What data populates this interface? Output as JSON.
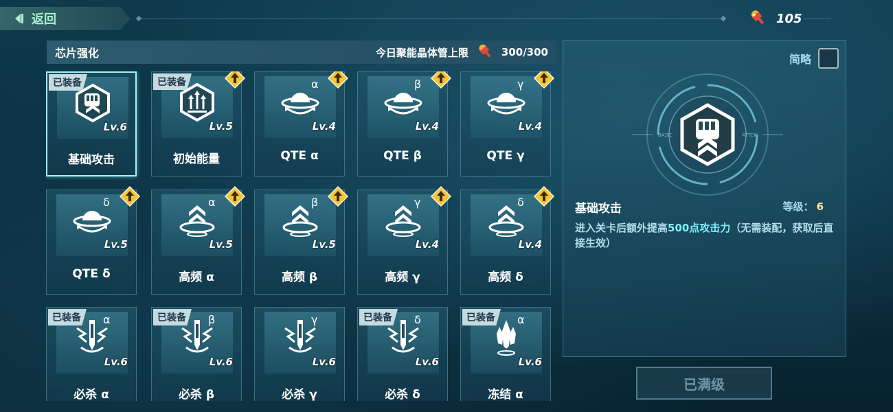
{
  "topbar": {
    "back_label": "返回",
    "currency_value": "105"
  },
  "header": {
    "title": "芯片强化",
    "limit_label": "今日聚能晶体管上限",
    "limit_value": "300/300"
  },
  "chips": [
    {
      "name": "基础攻击",
      "level": "Lv.6",
      "greek": "",
      "equipped": true,
      "upgradable": false,
      "icon": "fist-hexagon-icon",
      "selected": true
    },
    {
      "name": "初始能量",
      "level": "Lv.5",
      "greek": "",
      "equipped": true,
      "upgradable": true,
      "icon": "energy-hexagon-icon"
    },
    {
      "name": "QTE α",
      "level": "Lv.4",
      "greek": "α",
      "equipped": false,
      "upgradable": true,
      "icon": "qte-dome-icon"
    },
    {
      "name": "QTE β",
      "level": "Lv.4",
      "greek": "β",
      "equipped": false,
      "upgradable": true,
      "icon": "qte-dome-icon"
    },
    {
      "name": "QTE γ",
      "level": "Lv.4",
      "greek": "γ",
      "equipped": false,
      "upgradable": true,
      "icon": "qte-dome-icon"
    },
    {
      "name": "QTE δ",
      "level": "Lv.5",
      "greek": "δ",
      "equipped": false,
      "upgradable": true,
      "icon": "qte-dome-icon"
    },
    {
      "name": "高频 α",
      "level": "Lv.5",
      "greek": "α",
      "equipped": false,
      "upgradable": true,
      "icon": "chevron-ring-icon"
    },
    {
      "name": "高频 β",
      "level": "Lv.5",
      "greek": "β",
      "equipped": false,
      "upgradable": true,
      "icon": "chevron-ring-icon"
    },
    {
      "name": "高频 γ",
      "level": "Lv.4",
      "greek": "γ",
      "equipped": false,
      "upgradable": true,
      "icon": "chevron-ring-icon"
    },
    {
      "name": "高频 δ",
      "level": "Lv.4",
      "greek": "δ",
      "equipped": false,
      "upgradable": true,
      "icon": "chevron-ring-icon"
    },
    {
      "name": "必杀 α",
      "level": "Lv.6",
      "greek": "α",
      "equipped": true,
      "upgradable": false,
      "icon": "sword-lightning-icon"
    },
    {
      "name": "必杀 β",
      "level": "Lv.6",
      "greek": "β",
      "equipped": true,
      "upgradable": false,
      "icon": "sword-lightning-icon"
    },
    {
      "name": "必杀 γ",
      "level": "Lv.6",
      "greek": "γ",
      "equipped": false,
      "upgradable": false,
      "icon": "sword-lightning-icon"
    },
    {
      "name": "必杀 δ",
      "level": "Lv.6",
      "greek": "δ",
      "equipped": true,
      "upgradable": false,
      "icon": "sword-lightning-icon"
    },
    {
      "name": "冻结 α",
      "level": "Lv.6",
      "greek": "α",
      "equipped": true,
      "upgradable": false,
      "icon": "ice-crystal-icon"
    }
  ],
  "equipped_label": "已装备",
  "detail": {
    "simple_label": "简略",
    "title": "基础攻击",
    "level_label": "等级：",
    "level_value": "6",
    "desc_before": "进入关卡后额外提高",
    "desc_highlight": "500点攻击力",
    "desc_after": "（无需装配，获取后直接生效）",
    "emblem_left_text": "BASIC",
    "emblem_right_text": "ATTCK"
  },
  "maxed_button": "已满级",
  "colors": {
    "accent": "#9ff6f2",
    "highlight": "#7ff0ff",
    "badge": "#f3c437"
  }
}
